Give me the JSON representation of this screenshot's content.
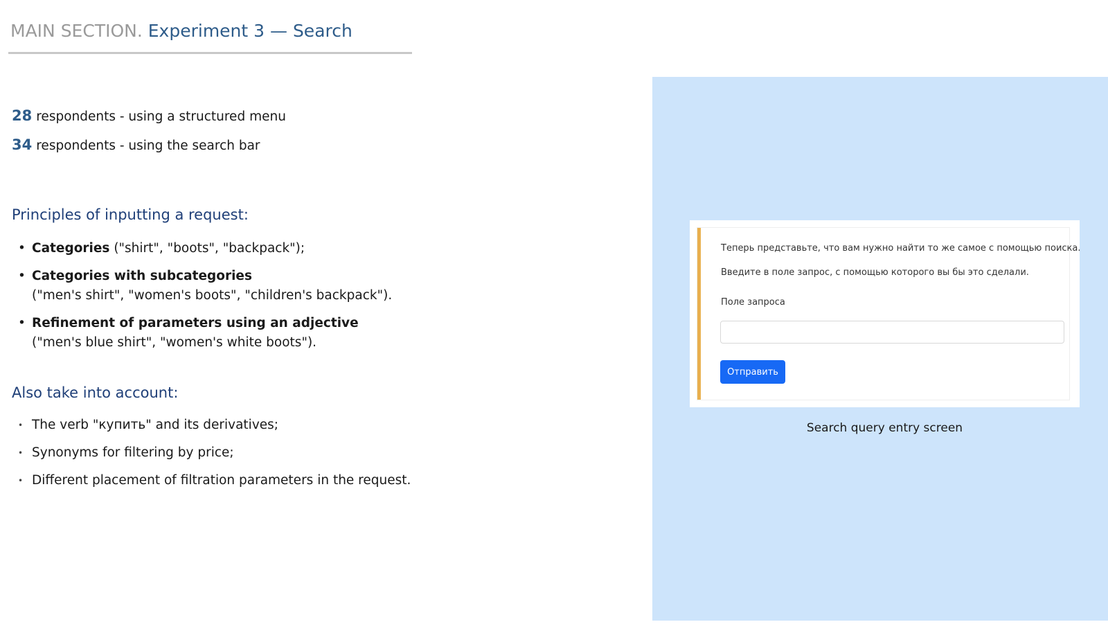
{
  "header": {
    "section_label": "MAIN SECTION.",
    "title": "Experiment 3 — Search"
  },
  "stats": [
    {
      "number": "28",
      "text": "respondents - using a structured menu"
    },
    {
      "number": "34",
      "text": "respondents - using the search bar"
    }
  ],
  "principles": {
    "heading": "Principles of inputting a request:",
    "items": [
      {
        "bold": "Categories",
        "rest": " (\"shirt\", \"boots\", \"backpack\");",
        "sub": ""
      },
      {
        "bold": "Categories with subcategories",
        "rest": "",
        "sub": "(\"men's shirt\", \"women's boots\", \"children's backpack\")."
      },
      {
        "bold": "Refinement of parameters using an adjective",
        "rest": "",
        "sub": "(\"men's blue shirt\", \"women's white boots\")."
      }
    ]
  },
  "also": {
    "heading": "Also take into account:",
    "items": [
      "The verb \"купить\" and its derivatives;",
      "Synonyms for filtering by price;",
      "Different placement of filtration parameters in the request."
    ]
  },
  "screenshot": {
    "instruction_1": "Теперь представьте, что вам нужно найти то же самое с помощью поиска.",
    "instruction_2": "Введите в поле запрос, с помощью которого вы бы это сделали.",
    "field_label": "Поле запроса",
    "field_value": "",
    "submit_label": "Отправить",
    "caption": "Search query entry screen"
  },
  "colors": {
    "accent": "#2e5c8a",
    "panel_bg": "#cde4fb",
    "card_bar": "#e9b04e",
    "button": "#1769f5"
  }
}
